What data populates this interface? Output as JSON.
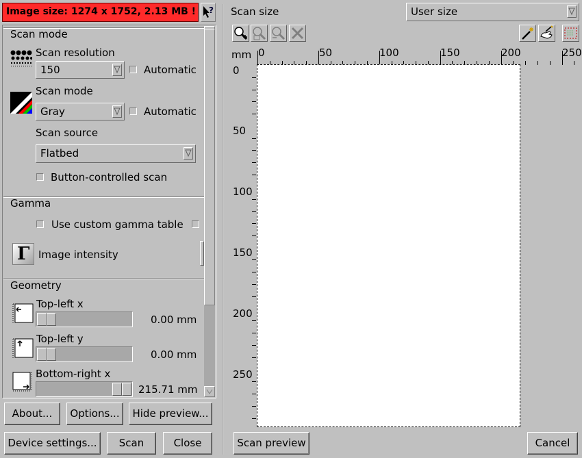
{
  "header": {
    "image_size_warning": "Image size: 1274 x 1752, 2.13 MB !",
    "warning_color": "#ff2a2a"
  },
  "left": {
    "scan_mode_group": {
      "title": "Scan mode",
      "resolution_label": "Scan resolution",
      "resolution_value": "150",
      "resolution_auto": "Automatic",
      "mode_label": "Scan mode",
      "mode_value": "Gray",
      "mode_auto": "Automatic",
      "source_label": "Scan source",
      "source_value": "Flatbed",
      "button_controlled": "Button-controlled scan"
    },
    "gamma_group": {
      "title": "Gamma",
      "custom_gamma": "Use custom gamma table",
      "intensity": "Image intensity",
      "gamma_glyph": "Γ"
    },
    "geometry_group": {
      "title": "Geometry",
      "tl_x_label": "Top-left x",
      "tl_x_value": "0.00 mm",
      "tl_y_label": "Top-left y",
      "tl_y_value": "0.00 mm",
      "br_x_label": "Bottom-right x",
      "br_x_value": "215.71 mm"
    }
  },
  "buttons": {
    "about": "About...",
    "options": "Options...",
    "hide_preview": "Hide preview...",
    "device_settings": "Device settings...",
    "scan": "Scan",
    "close": "Close",
    "scan_preview": "Scan preview",
    "cancel": "Cancel"
  },
  "preview": {
    "scan_size_label": "Scan size",
    "scan_size_value": "User size",
    "unit": "mm",
    "x_ticks": [
      "0",
      "50",
      "100",
      "150",
      "200",
      "250"
    ],
    "y_ticks": [
      "0",
      "50",
      "100",
      "150",
      "200",
      "250"
    ]
  }
}
